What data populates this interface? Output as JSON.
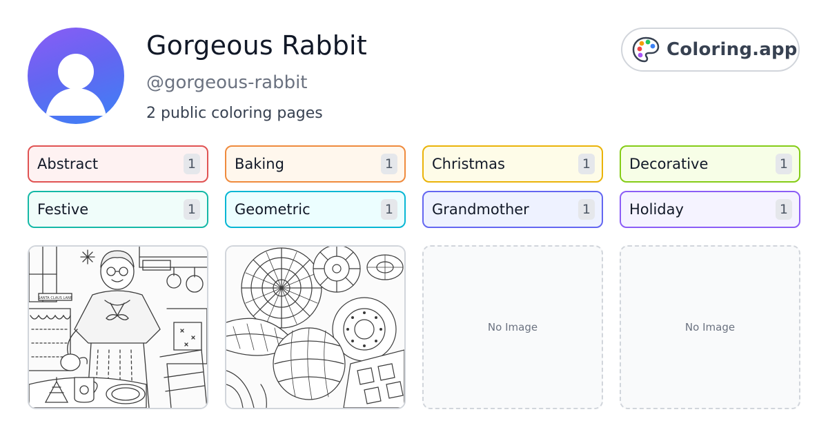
{
  "profile": {
    "name": "Gorgeous Rabbit",
    "handle": "@gorgeous-rabbit",
    "page_count_text": "2 public coloring pages"
  },
  "brand": {
    "label": "Coloring.app",
    "icon": "palette-icon"
  },
  "tags": [
    {
      "label": "Abstract",
      "count": "1",
      "border": "#e05252",
      "bg": "#fef2f2"
    },
    {
      "label": "Baking",
      "count": "1",
      "border": "#ef8a3c",
      "bg": "#fff7ed"
    },
    {
      "label": "Christmas",
      "count": "1",
      "border": "#eab308",
      "bg": "#fefce8"
    },
    {
      "label": "Decorative",
      "count": "1",
      "border": "#84cc16",
      "bg": "#f7fee7"
    },
    {
      "label": "Festive",
      "count": "1",
      "border": "#14b8a6",
      "bg": "#f0fdfa"
    },
    {
      "label": "Geometric",
      "count": "1",
      "border": "#06b6d4",
      "bg": "#ecfeff"
    },
    {
      "label": "Grandmother",
      "count": "1",
      "border": "#6366f1",
      "bg": "#eef2ff"
    },
    {
      "label": "Holiday",
      "count": "1",
      "border": "#8b5cf6",
      "bg": "#f5f3ff"
    }
  ],
  "cards": [
    {
      "type": "image",
      "subject": "grandmother-baking-kitchen",
      "sign_text": "SANTA CLAUS LANE"
    },
    {
      "type": "image",
      "subject": "abstract-geometric-pattern"
    },
    {
      "type": "empty",
      "label": "No Image"
    },
    {
      "type": "empty",
      "label": "No Image"
    }
  ]
}
